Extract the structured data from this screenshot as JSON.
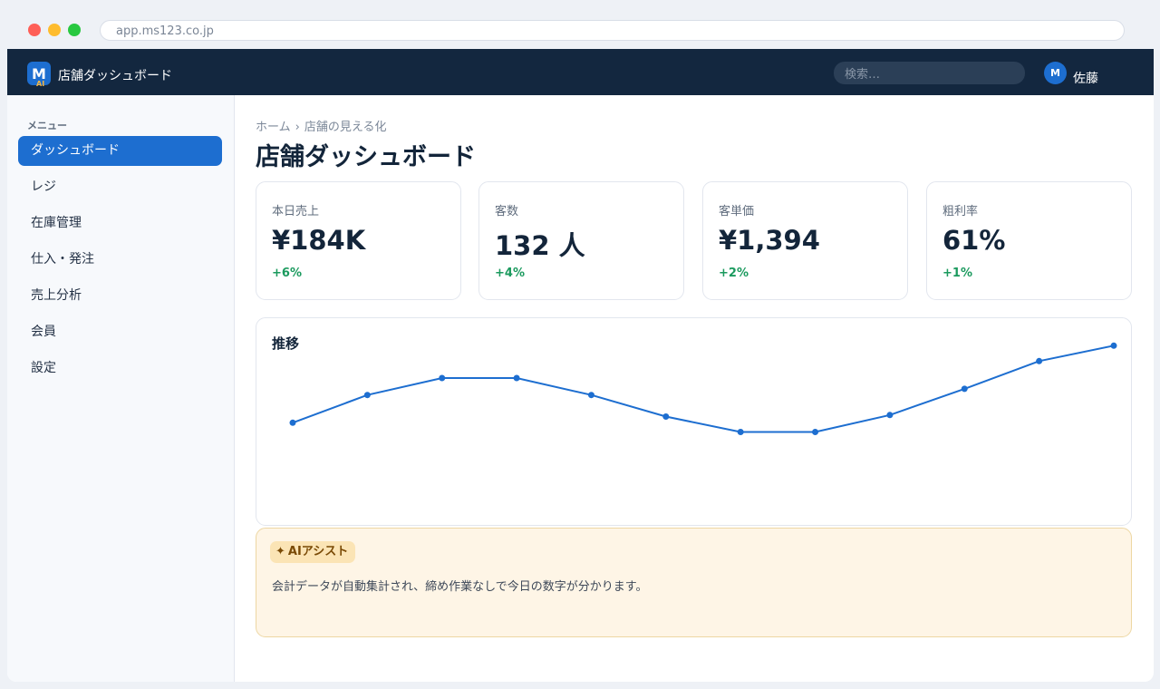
{
  "browser": {
    "url": "app.ms123.co.jp"
  },
  "topbar": {
    "logo_letter": "M",
    "logo_sub": "AI",
    "title": "店舗ダッシュボード",
    "search_placeholder": "検索…",
    "avatar_letter": "M",
    "username": "佐藤"
  },
  "sidebar": {
    "header": "メニュー",
    "items": [
      {
        "label": "ダッシュボード",
        "active": true
      },
      {
        "label": "レジ"
      },
      {
        "label": "在庫管理"
      },
      {
        "label": "仕入・発注"
      },
      {
        "label": "売上分析"
      },
      {
        "label": "会員"
      },
      {
        "label": "設定"
      }
    ]
  },
  "breadcrumb": {
    "home": "ホーム",
    "separator": "›",
    "current": "店舗の見える化"
  },
  "page_title": "店舗ダッシュボード",
  "kpis": [
    {
      "label": "本日売上",
      "value": "¥184K",
      "delta": "+6%"
    },
    {
      "label": "客数",
      "value": "132 人",
      "delta": "+4%"
    },
    {
      "label": "客単価",
      "value": "¥1,394",
      "delta": "+2%"
    },
    {
      "label": "粗利率",
      "value": "61%",
      "delta": "+1%"
    }
  ],
  "chart": {
    "title": "推移"
  },
  "chart_data": {
    "type": "line",
    "title": "推移",
    "x": [
      1,
      2,
      3,
      4,
      5,
      6,
      7,
      8,
      9,
      10,
      11,
      12
    ],
    "values": [
      41,
      59,
      70,
      70,
      59,
      45,
      35,
      35,
      46,
      63,
      81,
      91
    ],
    "ylim": [
      0,
      100
    ],
    "grid": false,
    "color": "#1d6ed0"
  },
  "ai": {
    "badge_icon": "sparkle-icon",
    "badge_label": "AIアシスト",
    "message": "会計データが自動集計され、締め作業なしで今日の数字が分かります。"
  },
  "colors": {
    "topbar": "#13273f",
    "accent": "#1d6ed0",
    "positive": "#1b9a5e",
    "ai_background": "#fef5e6"
  }
}
